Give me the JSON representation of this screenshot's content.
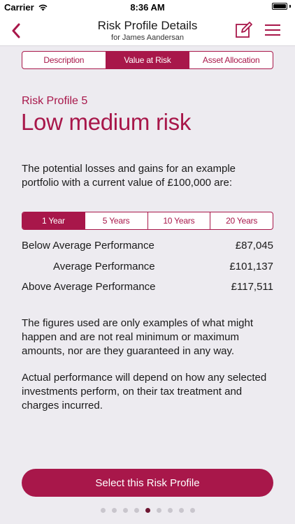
{
  "status_bar": {
    "carrier": "Carrier",
    "time": "8:36 AM"
  },
  "nav": {
    "title": "Risk Profile Details",
    "subtitle": "for James Aandersan"
  },
  "tabs": [
    {
      "label": "Description",
      "active": false
    },
    {
      "label": "Value at Risk",
      "active": true
    },
    {
      "label": "Asset Allocation",
      "active": false
    }
  ],
  "profile": {
    "label": "Risk Profile 5",
    "name": "Low medium risk"
  },
  "intro_text": "The potential losses and gains for an example portfolio with a current value of £100,000 are:",
  "periods": [
    {
      "label": "1 Year",
      "active": true
    },
    {
      "label": "5 Years",
      "active": false
    },
    {
      "label": "10 Years",
      "active": false
    },
    {
      "label": "20 Years",
      "active": false
    }
  ],
  "performance": [
    {
      "label": "Below Average Performance",
      "value": "£87,045"
    },
    {
      "label": "Average Performance",
      "value": "£101,137"
    },
    {
      "label": "Above Average Performance",
      "value": "£117,511"
    }
  ],
  "notes": [
    "The figures used are only examples of what might happen and are not real minimum or maximum amounts, nor are they guaranteed in any way.",
    "Actual performance will depend on how any selected investments perform, on their tax treatment and charges incurred."
  ],
  "select_button_label": "Select this Risk Profile",
  "page_indicator": {
    "count": 9,
    "current": 5
  },
  "colors": {
    "accent": "#a8174a",
    "background": "#edebf0",
    "active_dot": "#6e1632"
  },
  "icons": {
    "back": "chevron-left-icon",
    "edit": "edit-icon",
    "menu": "hamburger-menu-icon",
    "wifi": "wifi-icon",
    "battery": "battery-icon"
  }
}
